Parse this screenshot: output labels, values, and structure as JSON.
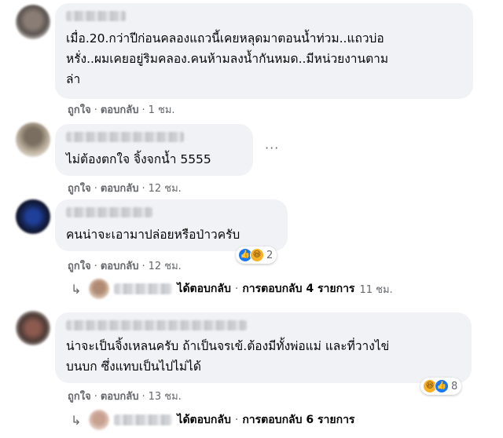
{
  "comments": [
    {
      "text_lines": [
        "เมื่อ.20.กว่าปีก่อนคลองแถวนี้เคยหลุดมาตอนน้ำท่วม..แถวบ่อ",
        "หรั่ง..ผมเคยอยู่ริมคลอง.คนห้ามลงน้ำกันหมด..มีหน่วยงานตาม",
        "ล่า"
      ],
      "like": "ถูกใจ",
      "reply": "ตอบกลับ",
      "time": "1 ชม."
    },
    {
      "text_lines": [
        "ไม่ต้องตกใจ จิ้งจกน้ำ 5555"
      ],
      "like": "ถูกใจ",
      "reply": "ตอบกลับ",
      "time": "12 ชม.",
      "more": "···"
    },
    {
      "text_lines": [
        "คนน่าจะเอามาปล่อยหรือป่าวครับ"
      ],
      "like": "ถูกใจ",
      "reply": "ตอบกลับ",
      "time": "12 ชม.",
      "reactions": {
        "icons": [
          "like-icon",
          "haha-icon"
        ],
        "count": "2"
      },
      "replies": {
        "replied": "ได้ตอบกลับ",
        "sep": "·",
        "summary": "การตอบกลับ 4 รายการ",
        "time": "11 ชม."
      }
    },
    {
      "text_lines": [
        "น่าจะเป็นจิ้งเหลนครับ ถ้าเป็นจรเข้.ต้องมีทั้งพ่อแม่ และที่วางไข่",
        "บนบก ซึ่งแทบเป็นไปไม่ได้"
      ],
      "like": "ถูกใจ",
      "reply": "ตอบกลับ",
      "time": "13 ชม.",
      "reactions": {
        "icons": [
          "haha-icon",
          "like-icon"
        ],
        "count": "8"
      },
      "replies": {
        "replied": "ได้ตอบกลับ",
        "sep": "·",
        "summary": "การตอบกลับ 6 รายการ",
        "time": ""
      }
    }
  ],
  "colors": {
    "bubble": "#f0f2f5",
    "muted": "#65676b",
    "like_blue": "#1877f2",
    "haha_yellow": "#f7b125"
  }
}
